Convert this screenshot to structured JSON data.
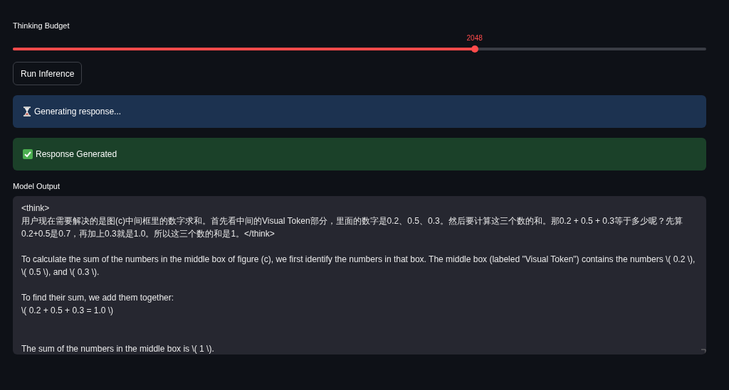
{
  "slider": {
    "label": "Thinking Budget",
    "value": "2048",
    "level": 0.666
  },
  "button": {
    "label": "Run Inference"
  },
  "alerts": [
    {
      "kind": "info",
      "text": "Generating response..."
    },
    {
      "kind": "success",
      "text": "Response Generated"
    }
  ],
  "output": {
    "label": "Model Output",
    "value": "<think>\n用户现在需要解决的是图(c)中间框里的数字求和。首先看中间的Visual Token部分，里面的数字是0.2、0.5、0.3。然后要计算这三个数的和。那0.2 + 0.5 + 0.3等于多少呢？先算0.2+0.5是0.7，再加上0.3就是1.0。所以这三个数的和是1。</think>\n\nTo calculate the sum of the numbers in the middle box of figure (c), we first identify the numbers in that box. The middle box (labeled \"Visual Token\") contains the numbers \\( 0.2 \\), \\( 0.5 \\), and \\( 0.3 \\).\n\nTo find their sum, we add them together:\n\\( 0.2 + 0.5 + 0.3 = 1.0 \\)\n\n\nThe sum of the numbers in the middle box is \\( 1 \\)."
  }
}
